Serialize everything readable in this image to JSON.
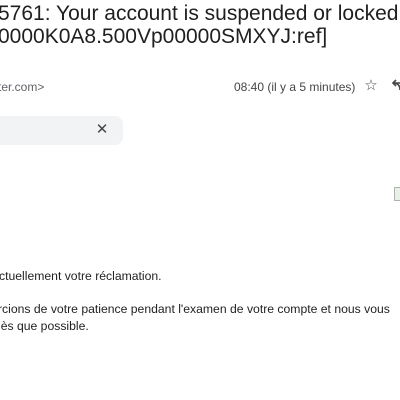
{
  "email": {
    "subject_line1": "5761: Your account is suspended or locked",
    "subject_line2": "0000K0A8.500Vp00000SMXYJ:ref]",
    "sender": "ter.com>",
    "time": "08:40 (il y a 5 minutes)",
    "star_icon": "star-icon",
    "reply_icon": "reply-icon"
  },
  "translate_bar": {
    "close_label": "✕"
  },
  "body": {
    "line1": "ctuellement votre réclamation.",
    "line2": "rcions de votre patience pendant l'examen de votre compte et nous vous",
    "line3": "lès que possible."
  }
}
